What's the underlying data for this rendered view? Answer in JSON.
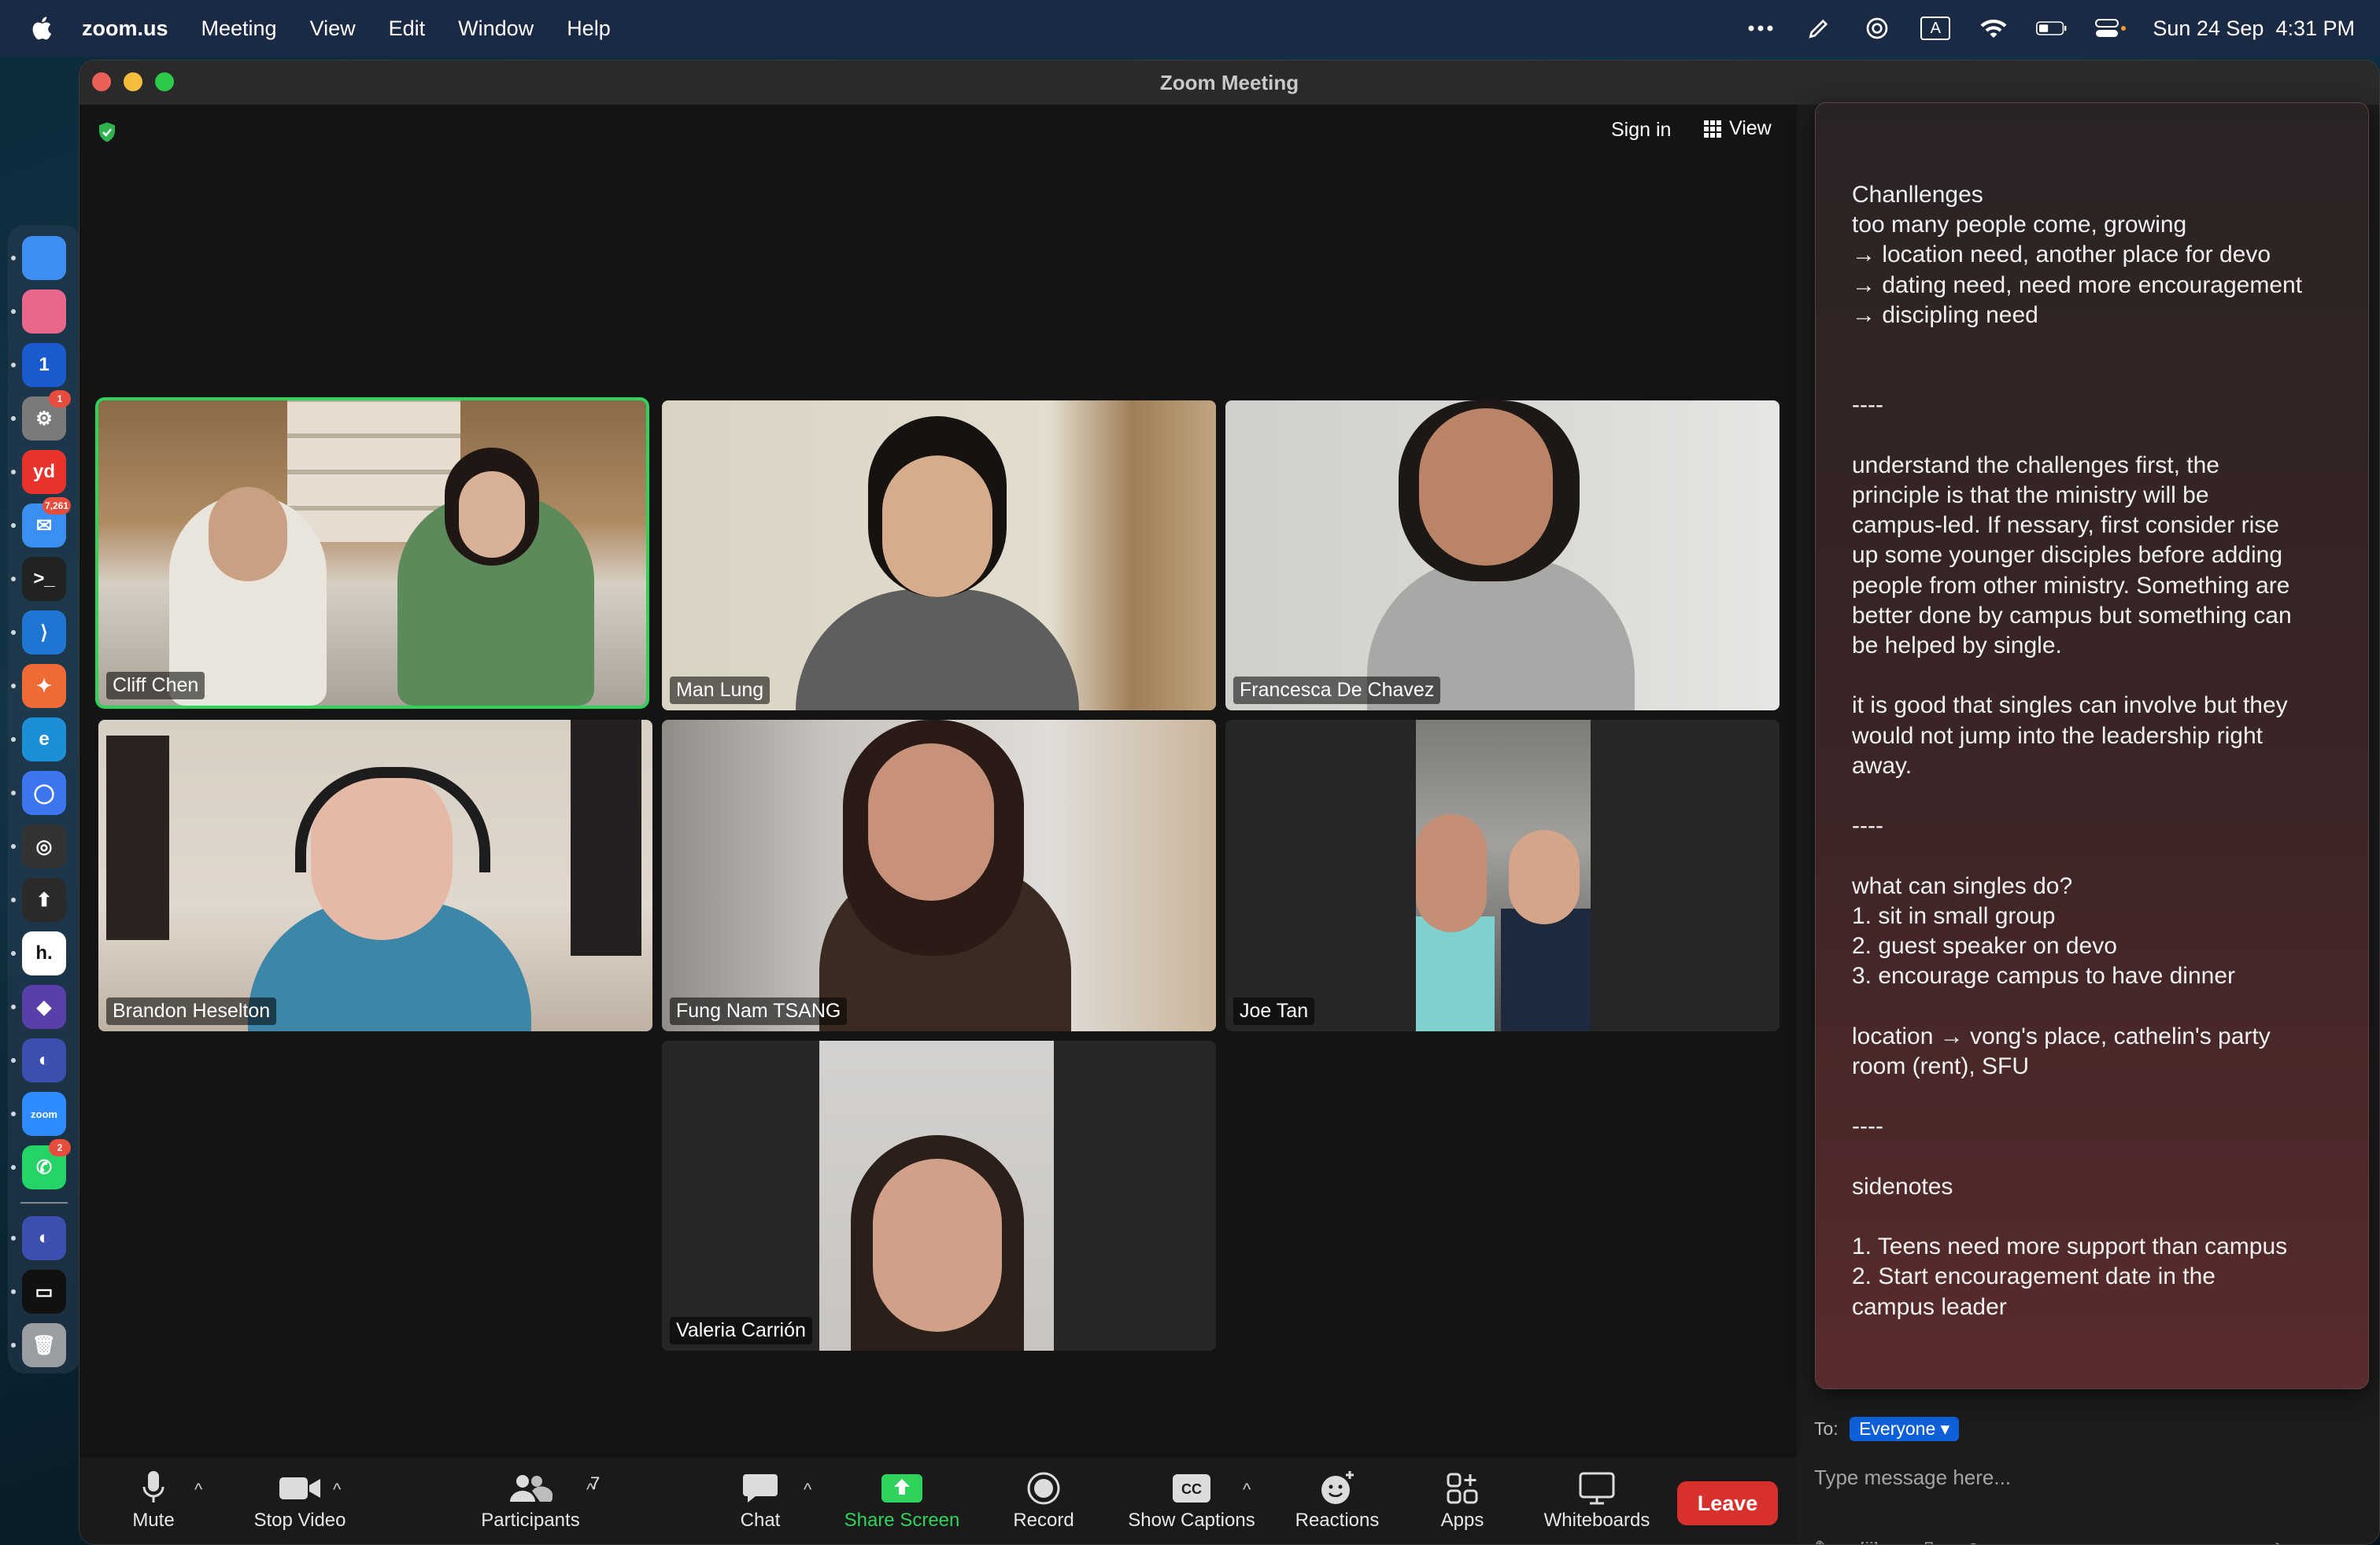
{
  "menubar": {
    "app_name": "zoom.us",
    "items": [
      "Meeting",
      "View",
      "Edit",
      "Window",
      "Help"
    ],
    "status_icons": [
      "more-icon",
      "pen-icon",
      "airdrop-icon",
      "keyboard-input-icon",
      "wifi-icon",
      "battery-icon",
      "control-center-icon"
    ],
    "input_source": "A",
    "datetime": "Sun 24 Sep  4:31 PM"
  },
  "dock": {
    "apps": [
      {
        "name": "finder-icon",
        "color": "#3d8ef0",
        "glyph": ""
      },
      {
        "name": "pink-app-icon",
        "color": "#e8678b",
        "glyph": ""
      },
      {
        "name": "1password-icon",
        "color": "#1a5ccf",
        "glyph": "1"
      },
      {
        "name": "system-settings-icon",
        "color": "#7a7a7a",
        "glyph": "⚙",
        "badge": "1"
      },
      {
        "name": "youdao-icon",
        "color": "#e8322b",
        "glyph": "yd"
      },
      {
        "name": "mail-icon",
        "color": "#3a8ff0",
        "glyph": "✉",
        "badge": "7,261"
      },
      {
        "name": "terminal-icon",
        "color": "#222222",
        "glyph": ">_"
      },
      {
        "name": "vscode-icon",
        "color": "#1f76d2",
        "glyph": "⟩"
      },
      {
        "name": "postman-icon",
        "color": "#f06a35",
        "glyph": "✦"
      },
      {
        "name": "edge-icon",
        "color": "#1b8fd8",
        "glyph": "e"
      },
      {
        "name": "signal-icon",
        "color": "#3b76f0",
        "glyph": "◯"
      },
      {
        "name": "screen-recorder-icon",
        "color": "#333333",
        "glyph": "◎"
      },
      {
        "name": "tweaks-icon",
        "color": "#2a2a2a",
        "glyph": "⬆"
      },
      {
        "name": "h-app-icon",
        "color": "#ffffff",
        "glyph": "h."
      },
      {
        "name": "obsidian-icon",
        "color": "#5b3fa8",
        "glyph": "◆"
      },
      {
        "name": "browser-icon",
        "color": "#3c4fb0",
        "glyph": "◐"
      },
      {
        "name": "zoom-icon",
        "color": "#2d8cff",
        "glyph": "zoom"
      },
      {
        "name": "whatsapp-icon",
        "color": "#25d366",
        "glyph": "✆",
        "badge": "2"
      },
      {
        "name": "finder-window-icon",
        "color": "#3c4fb0",
        "glyph": "◐"
      },
      {
        "name": "terminal-window-icon",
        "color": "#111111",
        "glyph": "▭"
      },
      {
        "name": "trash-icon",
        "color": "#9a9ea3",
        "glyph": "🗑"
      }
    ]
  },
  "window": {
    "title": "Zoom Meeting",
    "sign_in": "Sign in",
    "view_label": "View"
  },
  "participants": [
    {
      "name": "Cliff Chen",
      "active": true
    },
    {
      "name": "Man Lung"
    },
    {
      "name": "Francesca De Chavez"
    },
    {
      "name": "Brandon Heselton"
    },
    {
      "name": "Fung Nam TSANG"
    },
    {
      "name": "Joe Tan"
    },
    {
      "name": "Valeria Carrión"
    }
  ],
  "toolbar": {
    "mute": "Mute",
    "stop_video": "Stop Video",
    "participants": "Participants",
    "participants_count": "7",
    "chat": "Chat",
    "share_screen": "Share Screen",
    "record": "Record",
    "show_captions": "Show Captions",
    "reactions": "Reactions",
    "apps": "Apps",
    "whiteboards": "Whiteboards",
    "leave": "Leave",
    "share_color": "#2fd35b",
    "leave_color": "#d8302c"
  },
  "chat": {
    "to_label": "To:",
    "recipient": "Everyone",
    "placeholder": "Type message here..."
  },
  "note": {
    "text": "Chanllenges\ntoo many people come, growing\n→ location need, another place for devo\n→ dating need, need more encouragement\n→ discipling need\n\n\n----\n\nunderstand the challenges first, the\nprinciple is that the ministry will be\ncampus-led. If nessary, first consider rise\nup some younger disciples before adding\npeople from other ministry. Something are\nbetter done by campus but something can\nbe helped by single.\n\nit is good that singles can involve but they\nwould not jump into the leadership right\naway.\n\n----\n\nwhat can singles do?\n1. sit in small group\n2. guest speaker on devo\n3. encourage campus to have dinner\n\nlocation → vong's place, cathelin's party\nroom (rent), SFU\n\n----\n\nsidenotes\n\n1. Teens need more support than campus\n2. Start encouragement date in the\ncampus leader"
  }
}
